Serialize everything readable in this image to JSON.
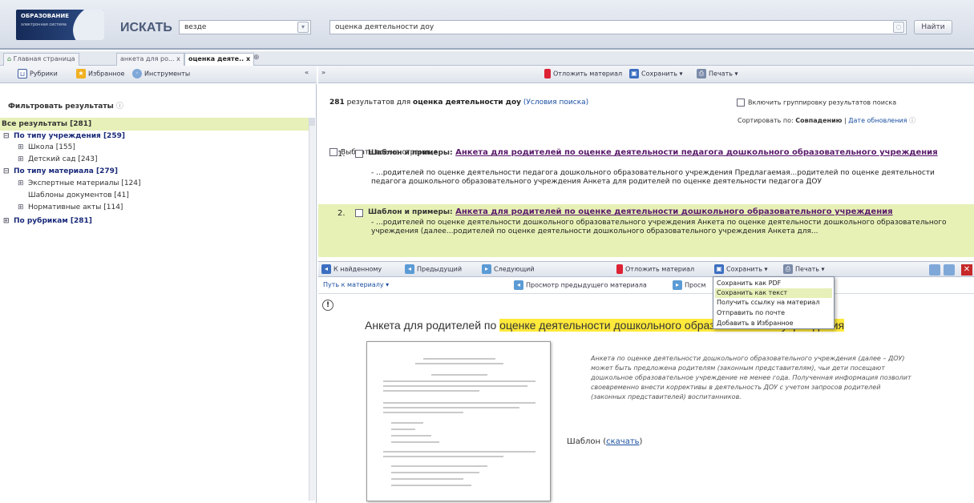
{
  "header": {
    "logo_line1": "ОБРАЗОВАНИЕ",
    "logo_line2": "электронная система",
    "search_label": "ИСКАТЬ",
    "scope_value": "везде",
    "query_value": "оценка деятельности доу",
    "find_button": "Найти"
  },
  "tabs": [
    {
      "label": "Главная страница"
    },
    {
      "label": "анкета для ро... x"
    },
    {
      "label": "оценка деяте.. x"
    }
  ],
  "left_toolbar": {
    "rubrics": "Рубрики",
    "favorites": "Избранное",
    "tools": "Инструменты",
    "collapse": "«"
  },
  "right_toolbar": {
    "expand": "»",
    "postpone": "Отложить материал",
    "save": "Сохранить",
    "print": "Печать"
  },
  "filter": {
    "title": "Фильтровать результаты",
    "all_results": "Все результаты [281]",
    "tree": [
      {
        "label": "По типу учреждения [259]",
        "level": 0,
        "prefix": "⊟"
      },
      {
        "label": "Школа [155]",
        "level": 1,
        "prefix": "⊞"
      },
      {
        "label": "Детский сад [243]",
        "level": 1,
        "prefix": "⊞"
      },
      {
        "label": "По типу материала [279]",
        "level": 0,
        "prefix": "⊟"
      },
      {
        "label": "Экспертные материалы [124]",
        "level": 1,
        "prefix": "⊞"
      },
      {
        "label": "Шаблоны документов [41]",
        "level": 1,
        "prefix": ""
      },
      {
        "label": "Нормативные акты [114]",
        "level": 1,
        "prefix": "⊞"
      },
      {
        "label": "По рубрикам [281]",
        "level": 0,
        "prefix": "⊞"
      }
    ]
  },
  "results": {
    "count_num": "281",
    "count_text": "результатов для",
    "count_query": "оценка деятельности доу",
    "conditions_link": "(Условия поиска)",
    "grouping": "Включить группировку результатов поиска",
    "sort_label": "Сортировать по:",
    "sort_active": "Совпадению",
    "sort_sep": "|",
    "sort_other": "Дате обновления",
    "select_all": "Выбрать все на странице",
    "items": [
      {
        "num": "1.",
        "prefix": "Шаблон и примеры:",
        "title": "Анкета для родителей по оценке деятельности педагога дошкольного образовательного учреждения",
        "snippet": "- ...родителей по оценке деятельности педагога дошкольного образовательного учреждения Предлагаемая...родителей по оценке деятельности педагога дошкольного образовательного учреждения Анкета для родителей по оценке деятельности педагога ДОУ"
      },
      {
        "num": "2.",
        "prefix": "Шаблон и примеры:",
        "title": "Анкета для родителей по оценке деятельности дошкольного образовательного учреждения",
        "snippet": "- ...родителей по оценке деятельности дошкольного образовательного учреждения Анкета по оценке деятельности дошкольного образовательного учреждения (далее...родителей по оценке деятельности дошкольного образовательного учреждения Анкета для..."
      }
    ]
  },
  "doc_toolbar": {
    "to_found": "К найденному",
    "previous": "Предыдущий",
    "next": "Следующий",
    "postpone": "Отложить материал",
    "save": "Сохранить",
    "print": "Печать"
  },
  "path_bar": {
    "path": "Путь к материалу",
    "preview_prev": "Просмотр предыдущего материала",
    "preview_next": "Просм"
  },
  "save_menu": [
    "Сохранить как PDF",
    "Сохранить как текст",
    "Получить ссылку на материал",
    "Отправить по почте",
    "Добавить в Избранное"
  ],
  "document": {
    "title_pre": "Анкета для родителей по",
    "title_hl": "оценке деятельности дошкольного образовательного учреждения",
    "desc": "Анкета по оценке деятельности дошкольного образовательного учреждения (далее – ДОУ) может быть предложена родителям (законным представителям), чьи дети посещают дошкольное образовательное учреждение не менее года. Полученная информация позволит своевременно внести коррективы в деятельность ДОУ с учетом запросов родителей (законных представителей) воспитанников.",
    "template_label": "Шаблон (",
    "template_link": "скачать",
    "template_end": ")"
  },
  "colors": {
    "highlight": "#ffe93b",
    "selected_bg": "#e6f0b8",
    "link": "#5a1a6b",
    "tree_heading": "#1a2a7a"
  }
}
